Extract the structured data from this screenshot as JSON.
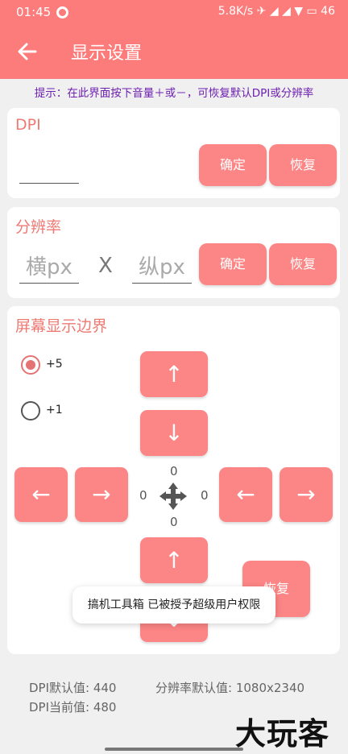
{
  "status_bar": {
    "time": "01:45",
    "right_text": "5.8K/s ✈ ◢ ◢ ▼ ▭ 46"
  },
  "app_bar": {
    "back_icon": "arrow-left-icon",
    "title": "显示设置"
  },
  "hint": "提示：在此界面按下音量＋或－，可恢复默认DPI或分辨率",
  "dpi_card": {
    "title": "DPI",
    "input_value": "",
    "confirm_label": "确定",
    "restore_label": "恢复"
  },
  "resolution_card": {
    "title": "分辨率",
    "width_placeholder": "横px",
    "separator": "X",
    "height_placeholder": "纵px",
    "confirm_label": "确定",
    "restore_label": "恢复"
  },
  "boundary_card": {
    "title": "屏幕显示边界",
    "step_options": [
      {
        "label": "+5",
        "checked": true
      },
      {
        "label": "+1",
        "checked": false
      }
    ],
    "up_arrow": "↑",
    "down_arrow": "↓",
    "left_arrow": "←",
    "right_arrow": "→",
    "offset_top": "0",
    "offset_left": "0",
    "offset_right": "0",
    "offset_bottom": "0",
    "restore_label": "恢复",
    "move_icon": "move-arrows-icon"
  },
  "toast": "搞机工具箱 已被授予超级用户权限",
  "info": {
    "dpi_default": "DPI默认值: 440",
    "dpi_current": "DPI当前值: 480",
    "resolution_default": "分辨率默认值: 1080x2340"
  },
  "watermark": "大玩客",
  "colors": {
    "accent": "#fc7b7b",
    "button": "#fc8585",
    "title": "#ee7a74",
    "hint": "#6d1fb0"
  }
}
